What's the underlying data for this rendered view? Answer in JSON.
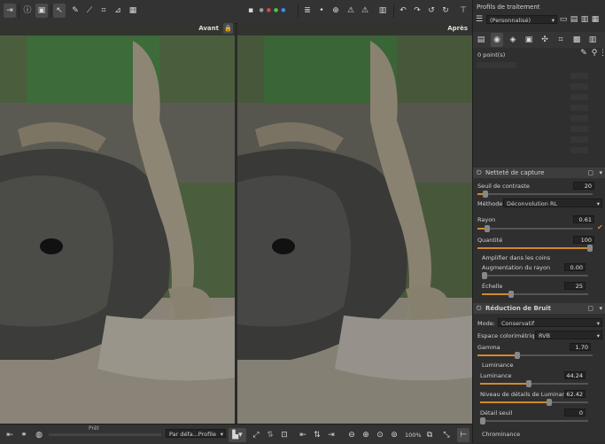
{
  "toolbar": {
    "left_icons": [
      "collapse-panel-icon",
      "info-icon",
      "before-after-icon",
      "hand-tool-icon",
      "color-picker-icon",
      "crop-icon",
      "straighten-icon",
      "perspective-icon"
    ],
    "right_icons": [
      "channel-r-icon",
      "channel-g-icon",
      "channel-b-icon",
      "channel-v-icon",
      "luminance-icon",
      "focus-mask-icon",
      "circle-icon",
      "plus-circle-icon",
      "warning-triangle-icon",
      "warning-icon",
      "histogram-icon",
      "undo-icon",
      "redo-icon",
      "rotate-left-icon",
      "rotate-right-icon",
      "flip-h-icon",
      "flip-v-icon"
    ]
  },
  "panes": {
    "before_label": "Avant",
    "after_label": "Après"
  },
  "bottom": {
    "status": "Prêt",
    "profile_select": "Par défa...",
    "profile_suffix": "Profile",
    "zoom": "100%"
  },
  "right_panel": {
    "title": "Profils de traitement",
    "profile": "(Personnalisé)",
    "points": "0 point(s)",
    "sharpen": {
      "title": "Netteté de capture",
      "contrast_label": "Seuil de contraste",
      "contrast_value": "20",
      "method_label": "Méthode:",
      "method_value": "Déconvolution RL",
      "radius_label": "Rayon",
      "radius_value": "0.61",
      "amount_label": "Quantité",
      "amount_value": "100",
      "corners_label": "Amplifier dans les coins",
      "radius_boost_label": "Augmentation du rayon",
      "radius_boost_value": "0.00",
      "scale_label": "Échelle",
      "scale_value": "25"
    },
    "noise": {
      "title": "Réduction de Bruit",
      "mode_label": "Mode:",
      "mode_value": "Conservatif",
      "colorspace_label": "Espace colorimétrique:",
      "colorspace_value": "RVB",
      "gamma_label": "Gamma",
      "gamma_value": "1.70",
      "luminance_header": "Luminance",
      "luminance_label": "Luminance",
      "luminance_value": "44.24",
      "detail_label": "Niveau de détails de Luminance",
      "detail_value": "62.42",
      "threshold_label": "Détail seuil",
      "threshold_value": "0",
      "chrominance_header": "Chrominance"
    }
  },
  "colors": {
    "accent": "#d08a2a",
    "panel": "#2f2f2f",
    "toolbar": "#333333"
  }
}
